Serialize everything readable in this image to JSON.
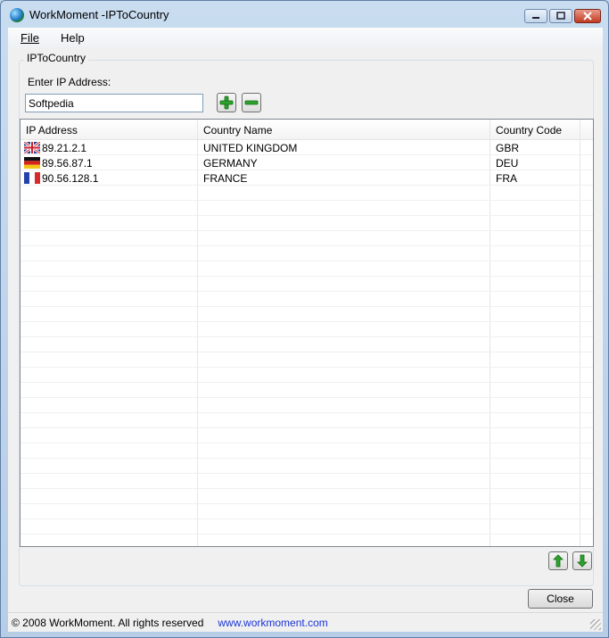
{
  "window": {
    "title": "WorkMoment -IPToCountry",
    "minimize_glyph": "▬",
    "maximize_glyph": "▣",
    "close_glyph": "✕"
  },
  "menu": {
    "file_label": "File",
    "help_label": "Help"
  },
  "group": {
    "label": "IPToCountry",
    "field_label": "Enter IP Address:",
    "ip_value": "Softpedia"
  },
  "table": {
    "columns": [
      "IP Address",
      "Country Name",
      "Country Code",
      ""
    ],
    "rows": [
      {
        "ip": "89.21.2.1",
        "country": "UNITED KINGDOM",
        "code": "GBR",
        "flag": "gb-flag-icon"
      },
      {
        "ip": "89.56.87.1",
        "country": "GERMANY",
        "code": "DEU",
        "flag": "de-flag-icon"
      },
      {
        "ip": "90.56.128.1",
        "country": "FRANCE",
        "code": "FRA",
        "flag": "fr-flag-icon"
      }
    ]
  },
  "buttons": {
    "close_label": "Close",
    "add_icon": "plus-icon",
    "remove_icon": "minus-icon",
    "up_icon": "arrow-up-icon",
    "down_icon": "arrow-down-icon"
  },
  "status": {
    "copyright": "© 2008 WorkMoment.  All rights reserved",
    "link": "www.workmoment.com"
  },
  "colors": {
    "accent_green": "#2da32d",
    "link_blue": "#1a33d6"
  }
}
